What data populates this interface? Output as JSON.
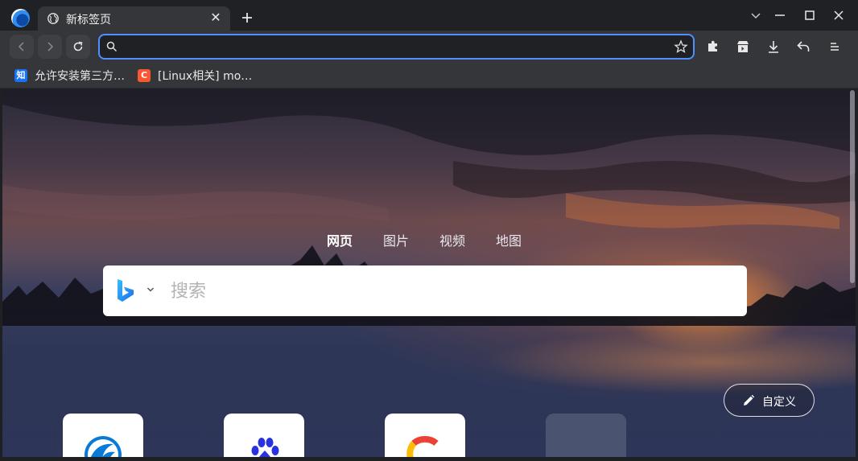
{
  "tab": {
    "title": "新标签页",
    "close_icon": "close-icon",
    "favicon": "globe-icon"
  },
  "window": {
    "controls": [
      "chevron-down-icon",
      "minimize-icon",
      "maximize-icon",
      "close-icon"
    ]
  },
  "toolbar": {
    "back_icon": "back-icon",
    "forward_icon": "forward-icon",
    "reload_icon": "reload-icon",
    "omnibox_value": "",
    "extensions_icon": "puzzle-icon",
    "store_icon": "store-icon",
    "download_icon": "download-icon",
    "undo_icon": "undo-icon",
    "menu_icon": "menu-icon"
  },
  "bookmarks": [
    {
      "label": "允许安装第三方…",
      "favicon_text": "知",
      "color": "#1772f6"
    },
    {
      "label": "[Linux相关] mo…",
      "favicon_text": "C",
      "color": "#fc5531"
    }
  ],
  "search": {
    "tabs": [
      "网页",
      "图片",
      "视频",
      "地图"
    ],
    "active_tab": "网页",
    "engine_icon": "bing-icon",
    "placeholder": "搜索"
  },
  "customize": {
    "label": "自定义"
  },
  "shortcuts": [
    "deepin-icon",
    "baidu-icon",
    "google-icon",
    "add-shortcut-icon"
  ],
  "colors": {
    "accent": "#4d90fe",
    "toolbar": "#35363a",
    "titlebar": "#202124"
  }
}
